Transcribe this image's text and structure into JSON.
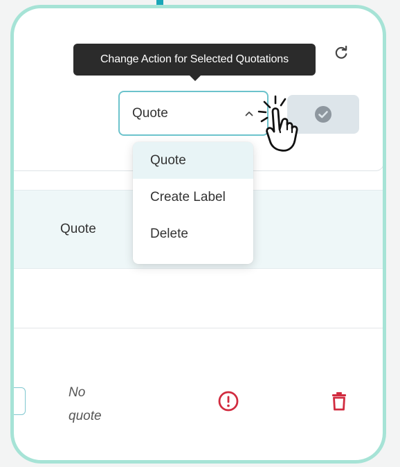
{
  "tooltip": {
    "text": "Change Action for Selected Quotations"
  },
  "action_select": {
    "value": "Quote",
    "options": [
      "Quote",
      "Create Label",
      "Delete"
    ],
    "selected_index": 0
  },
  "table": {
    "header_row_value": "Quote",
    "row": {
      "quote_status_line1": "No",
      "quote_status_line2": "quote"
    }
  },
  "icons": {
    "refresh": "refresh-icon",
    "chevron": "chevron-up-icon",
    "submit": "check-circle-icon",
    "pointer": "hand-pointer-icon",
    "warning": "alert-circle-icon",
    "delete": "trash-icon"
  },
  "colors": {
    "frame": "#a6e3d6",
    "accent": "#6cc3cc",
    "tooltip_bg": "#2b2b2b",
    "danger": "#d12b3f",
    "submit_bg": "#dde5ea"
  }
}
